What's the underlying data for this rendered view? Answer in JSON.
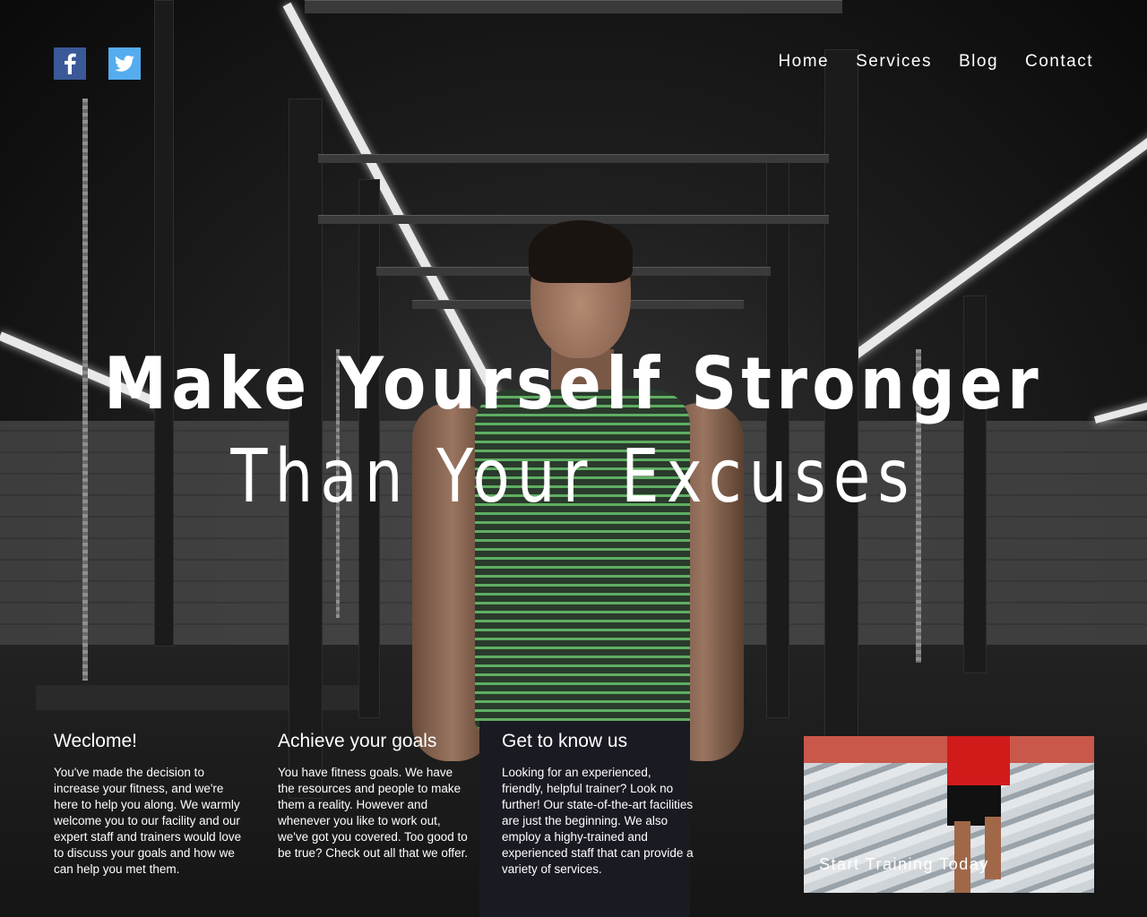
{
  "social": {
    "facebook_icon": "facebook-icon",
    "twitter_icon": "twitter-icon",
    "facebook_color": "#3b5998",
    "twitter_color": "#55acee"
  },
  "nav": {
    "items": [
      {
        "label": "Home"
      },
      {
        "label": "Services"
      },
      {
        "label": "Blog"
      },
      {
        "label": "Contact"
      }
    ]
  },
  "hero": {
    "line1": "Make Yourself Stronger",
    "line2": "Than Your Excuses"
  },
  "columns": [
    {
      "title": "Weclome!",
      "body": "You've made the decision to increase your fitness, and we're here to help you along. We warmly welcome you to our facility and our expert staff and trainers would love to discuss your goals and how we can help you met them."
    },
    {
      "title": "Achieve your goals",
      "body": "You have fitness goals. We have the resources and people to make them a reality. However and whenever you like to work out, we've got you covered. Too good to be true? Check out all that we offer."
    },
    {
      "title": "Get to know us",
      "body": "Looking for an experienced, friendly, helpful trainer? Look no further!  Our state-of-the-art facilities are just the beginning. We also employ a highy-trained and experienced staff that can provide a variety of services."
    }
  ],
  "promo": {
    "label": "Start Training Today"
  }
}
